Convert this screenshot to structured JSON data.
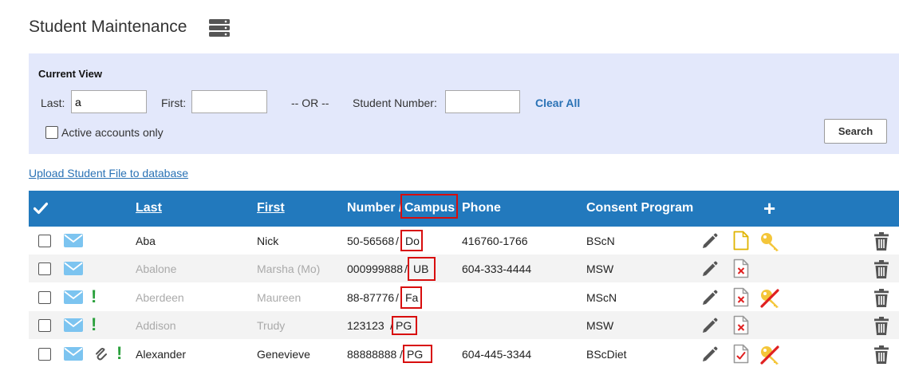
{
  "page": {
    "title": "Student Maintenance"
  },
  "filters": {
    "heading": "Current View",
    "last_label": "Last:",
    "last_value": "a",
    "first_label": "First:",
    "first_value": "",
    "or_text": "-- OR --",
    "student_number_label": "Student Number:",
    "student_number_value": "",
    "clear_all": "Clear All",
    "active_only_label": "Active accounts only",
    "active_only_checked": false,
    "search_button": "Search"
  },
  "upload_link": "Upload Student File to database",
  "table": {
    "headers": {
      "last": "Last",
      "first": "First",
      "number": "Number /",
      "campus": "Campus",
      "phone": "Phone",
      "consent_program": "Consent Program",
      "add": "+"
    },
    "rows": [
      {
        "last": "Aba",
        "first": "Nick",
        "number": "50-56568",
        "campus": "Do",
        "phone": "416760-1766",
        "program": "BScN",
        "active": true,
        "alert": false,
        "attachment": false,
        "doc_status": "new-file",
        "key_status": "active"
      },
      {
        "last": "Abalone",
        "first": "Marsha (Mo)",
        "number": "000999888",
        "campus": "UB",
        "phone": "604-333-4444",
        "program": "MSW",
        "active": false,
        "alert": false,
        "attachment": false,
        "doc_status": "rejected",
        "key_status": "none"
      },
      {
        "last": "Aberdeen",
        "first": "Maureen",
        "number": "88-87776",
        "campus": "Fa",
        "phone": "",
        "program": "MScN",
        "active": false,
        "alert": true,
        "attachment": false,
        "doc_status": "rejected",
        "key_status": "revoked"
      },
      {
        "last": "Addison",
        "first": "Trudy",
        "number": "123123",
        "campus": "PG",
        "phone": "",
        "program": "MSW",
        "active": false,
        "alert": true,
        "attachment": false,
        "doc_status": "rejected",
        "key_status": "none"
      },
      {
        "last": "Alexander",
        "first": "Genevieve",
        "number": "88888888",
        "campus": "PG",
        "phone": "604-445-3344",
        "program": "BScDiet",
        "active": true,
        "alert": true,
        "attachment": true,
        "doc_status": "approved",
        "key_status": "revoked"
      }
    ]
  },
  "colors": {
    "header_bg": "#2279bd",
    "filter_bg": "#e3e8fb",
    "link": "#2a72b5",
    "highlight_box": "#d80d0d",
    "alert": "#2aa03c",
    "mail": "#7cc4f0",
    "key": "#f4c63a"
  }
}
